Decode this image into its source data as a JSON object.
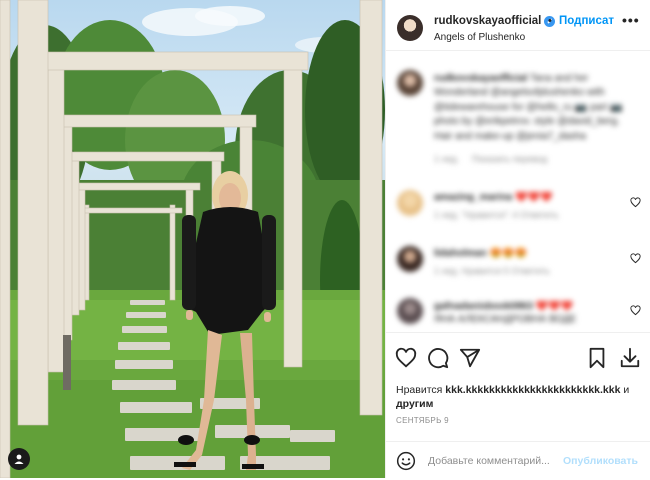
{
  "post": {
    "username": "rudkovskayaofficial",
    "follow_label": "Подписат",
    "location": "Angels of Plushenko",
    "more_label": "•••"
  },
  "caption": {
    "username": "rudkovskayaofficial",
    "text": "Tana and her Wonderland @angelsofplushenko with @tidewarehouse for @hello_ru 📷 part 📷 photo by @erikpetrov. style @david_berg. Hair and make-up @jenia7_dasha",
    "time": "1 нед.",
    "translate": "Показать перевод"
  },
  "comments": [
    {
      "username": "amazing_marina",
      "text": "❤️❤️❤️",
      "meta": "1 нед.    \"Нравится\": 4    Ответить"
    },
    {
      "username": "lidaholman",
      "text": "😍😍😍",
      "meta": "1 нед.    Нравится 5    Ответить"
    },
    {
      "username": "gafnadanisbook0863",
      "text": "❤️❤️❤️ ЯНА АЛЕКСАНДРОВНА ВОДЕ",
      "meta": ""
    }
  ],
  "likes": {
    "prefix": "Нравится",
    "who": "kkk.kkkkkkkkkkkkkkkkkkkkkkk.kkk",
    "suffix": "и",
    "others": "другим"
  },
  "date": "СЕНТЯБРЬ 9",
  "comment_input": {
    "placeholder": "Добавьте комментарий...",
    "publish_label": "Опубликовать"
  },
  "colors": {
    "accent": "#0095f6",
    "verified": "#3897f0",
    "publish_disabled": "#b2dffc",
    "heart_red": "#ed4956"
  },
  "icons": {
    "like": "heart-icon",
    "comment": "comment-icon",
    "share": "paper-plane-icon",
    "save": "bookmark-icon",
    "download": "download-icon",
    "emoji": "smiley-icon",
    "tag": "user-tag-icon"
  }
}
